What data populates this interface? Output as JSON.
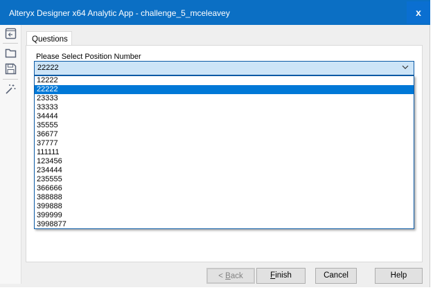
{
  "window": {
    "title": "Alteryx Designer x64 Analytic App - challenge_5_mceleavey",
    "close_label": "x"
  },
  "sidebar": {
    "icons": [
      "back-panel-icon",
      "folder-icon",
      "save-icon",
      "magic-wand-icon"
    ]
  },
  "tabs": [
    {
      "label": "Questions",
      "active": true
    }
  ],
  "question": {
    "label": "Please Select Position Number",
    "selected": "22222",
    "options": [
      "12222",
      "22222",
      "23333",
      "33333",
      "34444",
      "35555",
      "36677",
      "37777",
      "111111",
      "123456",
      "234444",
      "235555",
      "366666",
      "388888",
      "399888",
      "399999",
      "3998877"
    ]
  },
  "buttons": {
    "back": {
      "prefix": "< ",
      "mnemonic": "B",
      "rest": "ack",
      "enabled": false
    },
    "finish": {
      "mnemonic": "F",
      "rest": "inish"
    },
    "cancel": "Cancel",
    "help": "Help"
  },
  "colors": {
    "titlebar": "#0b6fc4",
    "selection": "#0078d7",
    "combo_bg": "#cce4f7"
  }
}
